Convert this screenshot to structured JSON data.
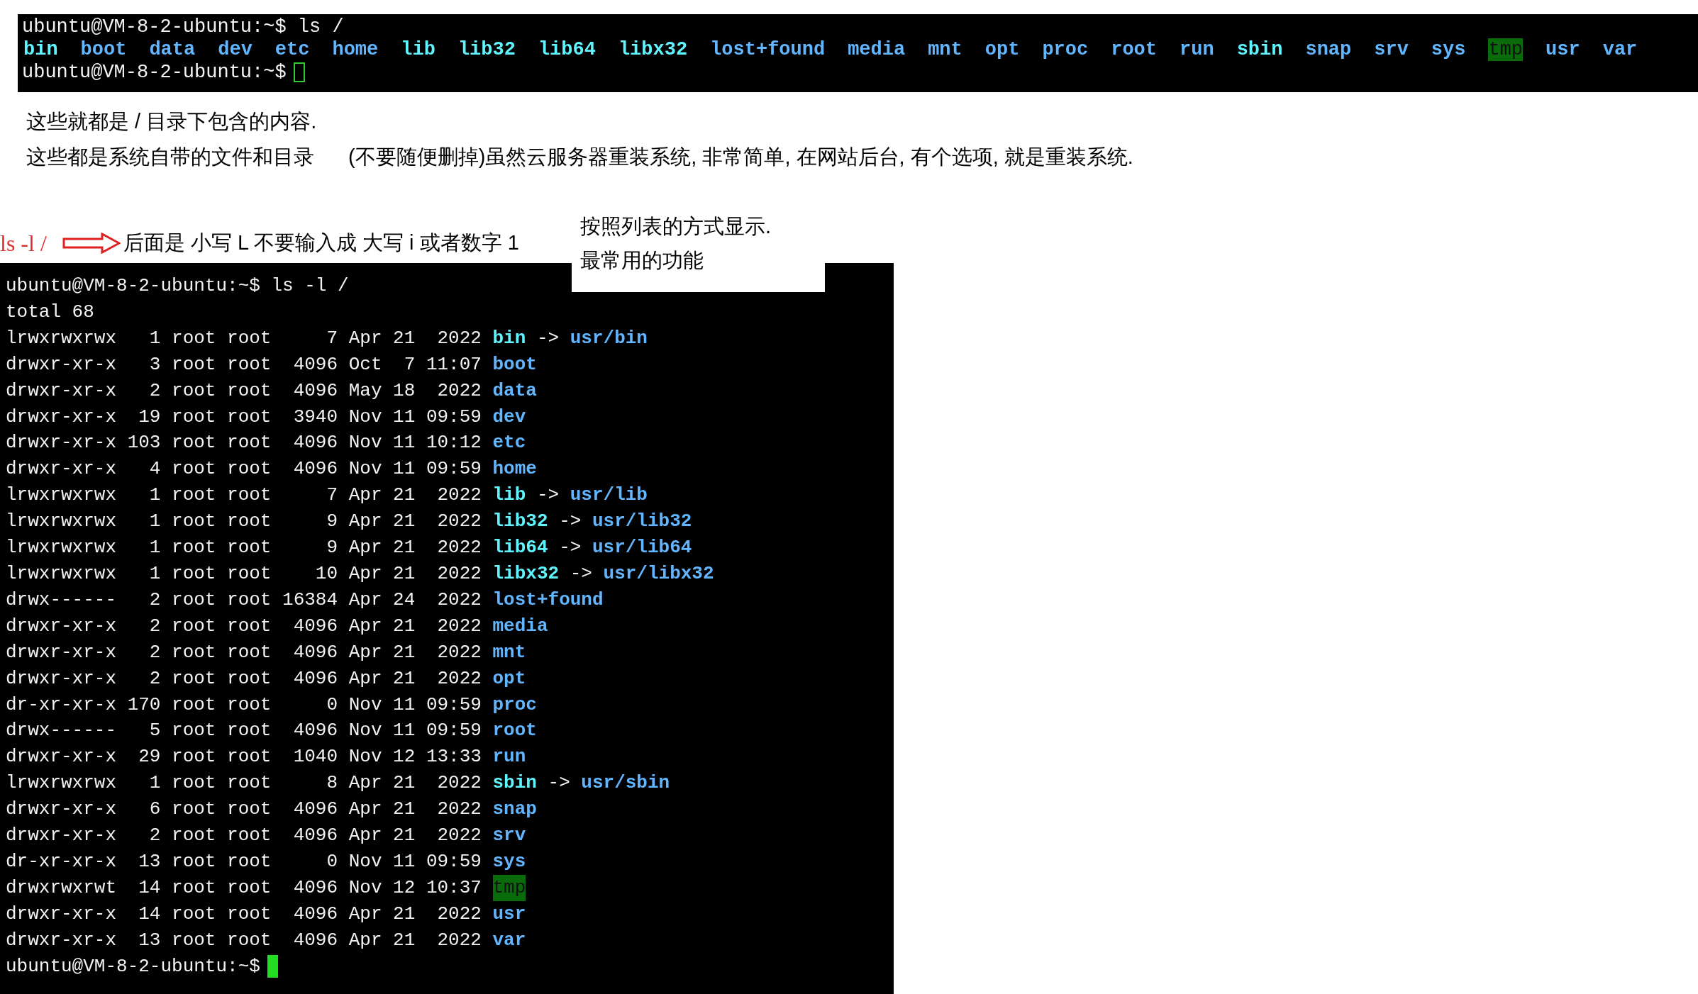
{
  "top_terminal": {
    "command_line": "ubuntu@VM-8-2-ubuntu:~$ ls /",
    "entries": [
      {
        "name": "bin",
        "kind": "link"
      },
      {
        "name": "boot",
        "kind": "dir"
      },
      {
        "name": "data",
        "kind": "dir"
      },
      {
        "name": "dev",
        "kind": "dir"
      },
      {
        "name": "etc",
        "kind": "dir"
      },
      {
        "name": "home",
        "kind": "dir"
      },
      {
        "name": "lib",
        "kind": "link"
      },
      {
        "name": "lib32",
        "kind": "link"
      },
      {
        "name": "lib64",
        "kind": "link"
      },
      {
        "name": "libx32",
        "kind": "link"
      },
      {
        "name": "lost+found",
        "kind": "dir"
      },
      {
        "name": "media",
        "kind": "dir"
      },
      {
        "name": "mnt",
        "kind": "dir"
      },
      {
        "name": "opt",
        "kind": "dir"
      },
      {
        "name": "proc",
        "kind": "dir"
      },
      {
        "name": "root",
        "kind": "dir"
      },
      {
        "name": "run",
        "kind": "dir"
      },
      {
        "name": "sbin",
        "kind": "link"
      },
      {
        "name": "snap",
        "kind": "dir"
      },
      {
        "name": "srv",
        "kind": "dir"
      },
      {
        "name": "sys",
        "kind": "dir"
      },
      {
        "name": "tmp",
        "kind": "sticky"
      },
      {
        "name": "usr",
        "kind": "dir"
      },
      {
        "name": "var",
        "kind": "dir"
      }
    ],
    "prompt": "ubuntu@VM-8-2-ubuntu:~$",
    "cursor_filled": false
  },
  "notes": [
    {
      "texts": [
        "这些就都是 / 目录下包含的内容."
      ]
    },
    {
      "texts": [
        "这些都是系统自带的文件和目录",
        "(不要随便删掉)虽然云服务器重装系统, 非常简单, 在网站后台, 有个选项, 就是重装系统."
      ]
    }
  ],
  "annotation": {
    "command": "ls -l /",
    "text": "后面是 小写 L 不要输入成 大写 i 或者数字 1"
  },
  "callout": [
    "按照列表的方式显示.",
    "最常用的功能"
  ],
  "listing_terminal": {
    "command_line": "ubuntu@VM-8-2-ubuntu:~$ ls -l /",
    "total": "total 68",
    "rows": [
      {
        "info": "lrwxrwxrwx   1 root root     7 Apr 21  2022",
        "name": "bin",
        "kind": "link",
        "arrow": "->",
        "target": "usr/bin"
      },
      {
        "info": "drwxr-xr-x   3 root root  4096 Oct  7 11:07",
        "name": "boot",
        "kind": "dir"
      },
      {
        "info": "drwxr-xr-x   2 root root  4096 May 18  2022",
        "name": "data",
        "kind": "dir"
      },
      {
        "info": "drwxr-xr-x  19 root root  3940 Nov 11 09:59",
        "name": "dev",
        "kind": "dir"
      },
      {
        "info": "drwxr-xr-x 103 root root  4096 Nov 11 10:12",
        "name": "etc",
        "kind": "dir"
      },
      {
        "info": "drwxr-xr-x   4 root root  4096 Nov 11 09:59",
        "name": "home",
        "kind": "dir"
      },
      {
        "info": "lrwxrwxrwx   1 root root     7 Apr 21  2022",
        "name": "lib",
        "kind": "link",
        "arrow": "->",
        "target": "usr/lib"
      },
      {
        "info": "lrwxrwxrwx   1 root root     9 Apr 21  2022",
        "name": "lib32",
        "kind": "link",
        "arrow": "->",
        "target": "usr/lib32"
      },
      {
        "info": "lrwxrwxrwx   1 root root     9 Apr 21  2022",
        "name": "lib64",
        "kind": "link",
        "arrow": "->",
        "target": "usr/lib64"
      },
      {
        "info": "lrwxrwxrwx   1 root root    10 Apr 21  2022",
        "name": "libx32",
        "kind": "link",
        "arrow": "->",
        "target": "usr/libx32"
      },
      {
        "info": "drwx------   2 root root 16384 Apr 24  2022",
        "name": "lost+found",
        "kind": "dir"
      },
      {
        "info": "drwxr-xr-x   2 root root  4096 Apr 21  2022",
        "name": "media",
        "kind": "dir"
      },
      {
        "info": "drwxr-xr-x   2 root root  4096 Apr 21  2022",
        "name": "mnt",
        "kind": "dir"
      },
      {
        "info": "drwxr-xr-x   2 root root  4096 Apr 21  2022",
        "name": "opt",
        "kind": "dir"
      },
      {
        "info": "dr-xr-xr-x 170 root root     0 Nov 11 09:59",
        "name": "proc",
        "kind": "dir"
      },
      {
        "info": "drwx------   5 root root  4096 Nov 11 09:59",
        "name": "root",
        "kind": "dir"
      },
      {
        "info": "drwxr-xr-x  29 root root  1040 Nov 12 13:33",
        "name": "run",
        "kind": "dir"
      },
      {
        "info": "lrwxrwxrwx   1 root root     8 Apr 21  2022",
        "name": "sbin",
        "kind": "link",
        "arrow": "->",
        "target": "usr/sbin"
      },
      {
        "info": "drwxr-xr-x   6 root root  4096 Apr 21  2022",
        "name": "snap",
        "kind": "dir"
      },
      {
        "info": "drwxr-xr-x   2 root root  4096 Apr 21  2022",
        "name": "srv",
        "kind": "dir"
      },
      {
        "info": "dr-xr-xr-x  13 root root     0 Nov 11 09:59",
        "name": "sys",
        "kind": "dir"
      },
      {
        "info": "drwxrwxrwt  14 root root  4096 Nov 12 10:37",
        "name": "tmp",
        "kind": "sticky"
      },
      {
        "info": "drwxr-xr-x  14 root root  4096 Apr 21  2022",
        "name": "usr",
        "kind": "dir"
      },
      {
        "info": "drwxr-xr-x  13 root root  4096 Apr 21  2022",
        "name": "var",
        "kind": "dir"
      }
    ],
    "prompt": "ubuntu@VM-8-2-ubuntu:~$",
    "cursor_filled": true
  }
}
